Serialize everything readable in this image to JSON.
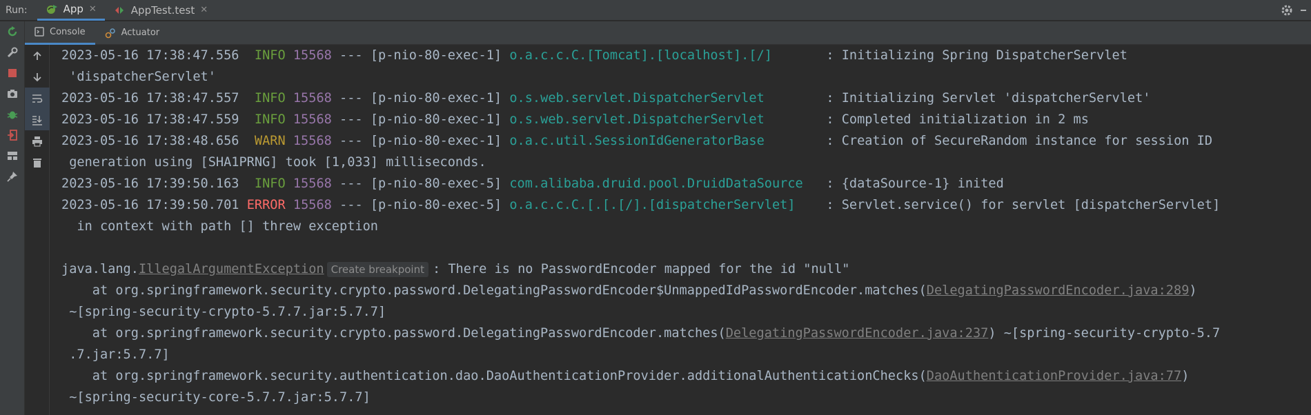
{
  "topbar": {
    "run_label": "Run:",
    "tabs": [
      {
        "label": "App",
        "close": "✕"
      },
      {
        "label": "AppTest.test",
        "close": "✕"
      }
    ],
    "settings_icon": "gear-icon",
    "minimize_icon": "minus-icon"
  },
  "subtabs": [
    {
      "label": "Console",
      "icon": "console-icon"
    },
    {
      "label": "Actuator",
      "icon": "actuator-icon"
    }
  ],
  "left_toolbar_icons": [
    "rerun-icon",
    "wrench-icon",
    "stop-icon",
    "camera-icon",
    "debug-icon",
    "exit-icon",
    "layout-icon",
    "pin-icon"
  ],
  "side_toolbar_icons": [
    "arrow-up-icon",
    "arrow-down-icon",
    "soft-wrap-icon",
    "scroll-to-end-icon",
    "print-icon",
    "trash-icon"
  ],
  "colors": {
    "info": "#6a9f3d",
    "warn": "#bb9a32",
    "error": "#ff6b68",
    "pid": "#9876aa",
    "logger": "#2aa198",
    "accent": "#4a88c7"
  },
  "console": {
    "log": [
      {
        "ts": "2023-05-16 17:38:47.556",
        "level": "INFO",
        "pid": "15568",
        "thread": "--- [p-nio-80-exec-1]",
        "logger": "o.a.c.c.C.[Tomcat].[localhost].[/]",
        "msg": ": Initializing Spring DispatcherServlet",
        "cont": "'dispatcherServlet'"
      },
      {
        "ts": "2023-05-16 17:38:47.557",
        "level": "INFO",
        "pid": "15568",
        "thread": "--- [p-nio-80-exec-1]",
        "logger": "o.s.web.servlet.DispatcherServlet",
        "msg": ": Initializing Servlet 'dispatcherServlet'"
      },
      {
        "ts": "2023-05-16 17:38:47.559",
        "level": "INFO",
        "pid": "15568",
        "thread": "--- [p-nio-80-exec-1]",
        "logger": "o.s.web.servlet.DispatcherServlet",
        "msg": ": Completed initialization in 2 ms"
      },
      {
        "ts": "2023-05-16 17:38:48.656",
        "level": "WARN",
        "pid": "15568",
        "thread": "--- [p-nio-80-exec-1]",
        "logger": "o.a.c.util.SessionIdGeneratorBase",
        "msg": ": Creation of SecureRandom instance for session ID",
        "cont": "generation using [SHA1PRNG] took [1,033] milliseconds."
      },
      {
        "ts": "2023-05-16 17:39:50.163",
        "level": "INFO",
        "pid": "15568",
        "thread": "--- [p-nio-80-exec-5]",
        "logger": "com.alibaba.druid.pool.DruidDataSource",
        "msg": ": {dataSource-1} inited"
      },
      {
        "ts": "2023-05-16 17:39:50.701",
        "level": "ERROR",
        "pid": "15568",
        "thread": "--- [p-nio-80-exec-5]",
        "logger": "o.a.c.c.C.[.[.[/].[dispatcherServlet]",
        "msg": ": Servlet.service() for servlet [dispatcherServlet]",
        "cont": " in context with path [] threw exception"
      }
    ],
    "exception": {
      "prefix": "java.lang.",
      "class_name": "IllegalArgumentException",
      "breakpoint": "Create breakpoint",
      "message": ": There is no PasswordEncoder mapped for the id \"null\""
    },
    "stack": [
      {
        "at": "    at org.springframework.security.crypto.password.DelegatingPasswordEncoder$UnmappedIdPasswordEncoder.matches(",
        "link": "DelegatingPasswordEncoder.java:289",
        "after": ")",
        "cont": " ~[spring-security-crypto-5.7.7.jar:5.7.7]"
      },
      {
        "at": "    at org.springframework.security.crypto.password.DelegatingPasswordEncoder.matches(",
        "link": "DelegatingPasswordEncoder.java:237",
        "after": ") ~[spring-security-crypto-5.7",
        "cont": " .7.jar:5.7.7]"
      },
      {
        "at": "    at org.springframework.security.authentication.dao.DaoAuthenticationProvider.additionalAuthenticationChecks(",
        "link": "DaoAuthenticationProvider.java:77",
        "after": ")",
        "cont": " ~[spring-security-core-5.7.7.jar:5.7.7]"
      }
    ]
  }
}
